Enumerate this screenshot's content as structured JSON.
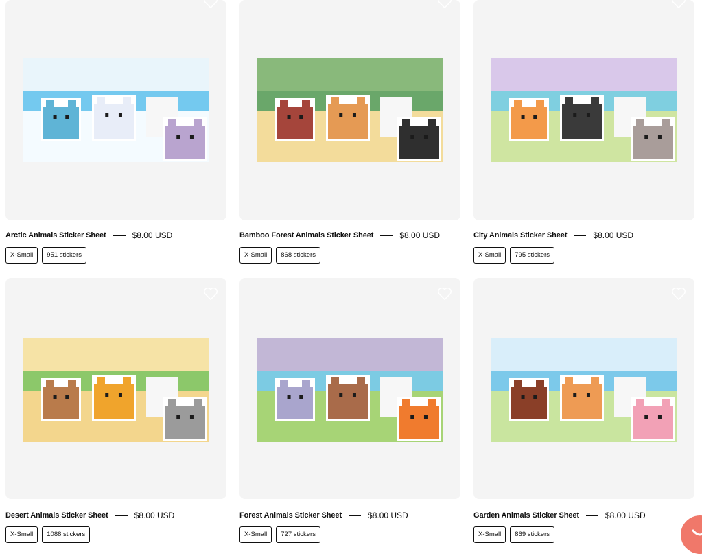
{
  "products": [
    {
      "name": "Arctic Animals Sticker Sheet",
      "price": "$8.00 USD",
      "tags": [
        "X-Small",
        "951 stickers"
      ],
      "sky": "#e9f5fb",
      "ground": "#f4fbff",
      "water": "#74c9ef",
      "stickers": [
        {
          "color": "#5fb4d6"
        },
        {
          "color": "#e8edf8"
        },
        {
          "color": "#b9a4cf"
        }
      ]
    },
    {
      "name": "Bamboo Forest Animals Sticker Sheet",
      "price": "$8.00 USD",
      "tags": [
        "X-Small",
        "868 stickers"
      ],
      "sky": "#89b97b",
      "ground": "#f3dc9b",
      "water": "#6aa76a",
      "stickers": [
        {
          "color": "#a5453b"
        },
        {
          "color": "#e59a54"
        },
        {
          "color": "#2f2f2f"
        }
      ]
    },
    {
      "name": "City Animals Sticker Sheet",
      "price": "$8.00 USD",
      "tags": [
        "X-Small",
        "795 stickers"
      ],
      "sky": "#d9c8ea",
      "ground": "#cfe5a1",
      "water": "#7fcfe0",
      "stickers": [
        {
          "color": "#f39a4a"
        },
        {
          "color": "#3a3a3a"
        },
        {
          "color": "#a99d9a"
        }
      ]
    },
    {
      "name": "Desert Animals Sticker Sheet",
      "price": "$8.00 USD",
      "tags": [
        "X-Small",
        "1088 stickers"
      ],
      "sky": "#f6e3a6",
      "ground": "#f3d68d",
      "water": "#8cc86a",
      "stickers": [
        {
          "color": "#b97b4b"
        },
        {
          "color": "#f0a42c"
        },
        {
          "color": "#9b9b9b"
        }
      ]
    },
    {
      "name": "Forest Animals Sticker Sheet",
      "price": "$8.00 USD",
      "tags": [
        "X-Small",
        "727 stickers"
      ],
      "sky": "#c2b7d6",
      "ground": "#a7d476",
      "water": "#7ccbe3",
      "stickers": [
        {
          "color": "#a9a5cd"
        },
        {
          "color": "#a96b4a"
        },
        {
          "color": "#f07b2e"
        }
      ]
    },
    {
      "name": "Garden Animals Sticker Sheet",
      "price": "$8.00 USD",
      "tags": [
        "X-Small",
        "869 stickers"
      ],
      "sky": "#d9eefa",
      "ground": "#c9e59f",
      "water": "#7cc9ea",
      "stickers": [
        {
          "color": "#8a3f28"
        },
        {
          "color": "#ee9b54"
        },
        {
          "color": "#f2a1b6"
        }
      ]
    }
  ]
}
